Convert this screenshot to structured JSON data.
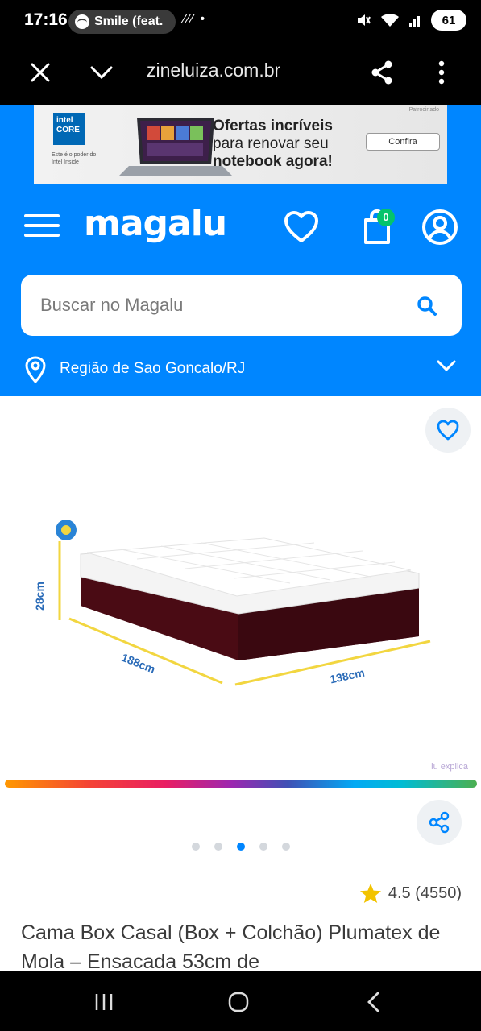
{
  "status": {
    "time": "17:16",
    "media": "Smile (feat.",
    "extra": "⁄⁄⁄ •",
    "battery": "61"
  },
  "browser": {
    "url": "zineluiza.com.br"
  },
  "ad": {
    "brand_line1": "intel",
    "brand_line2": "CORE",
    "tagline": "Este é o poder do Intel Inside",
    "headline_1": "Ofertas incríveis",
    "headline_2": "para renovar seu",
    "headline_3": "notebook agora!",
    "cta": "Confira",
    "label": "Patrocinado"
  },
  "header": {
    "logo": "magalu",
    "cart_count": "0"
  },
  "search": {
    "placeholder": "Buscar no Magalu"
  },
  "region": {
    "label": "Região de Sao Goncalo/RJ"
  },
  "product": {
    "dimensions": {
      "height": "28cm",
      "depth": "188cm",
      "width": "138cm"
    },
    "watermark": "lu explica",
    "gallery_total": 5,
    "gallery_active": 3,
    "rating": "4.5 (4550)",
    "title": "Cama Box Casal (Box + Colchão) Plumatex de Mola – Ensacada 53cm de"
  },
  "colors": {
    "brand_blue": "#0086ff",
    "cart_badge": "#05c46b",
    "star": "#f2c300"
  }
}
